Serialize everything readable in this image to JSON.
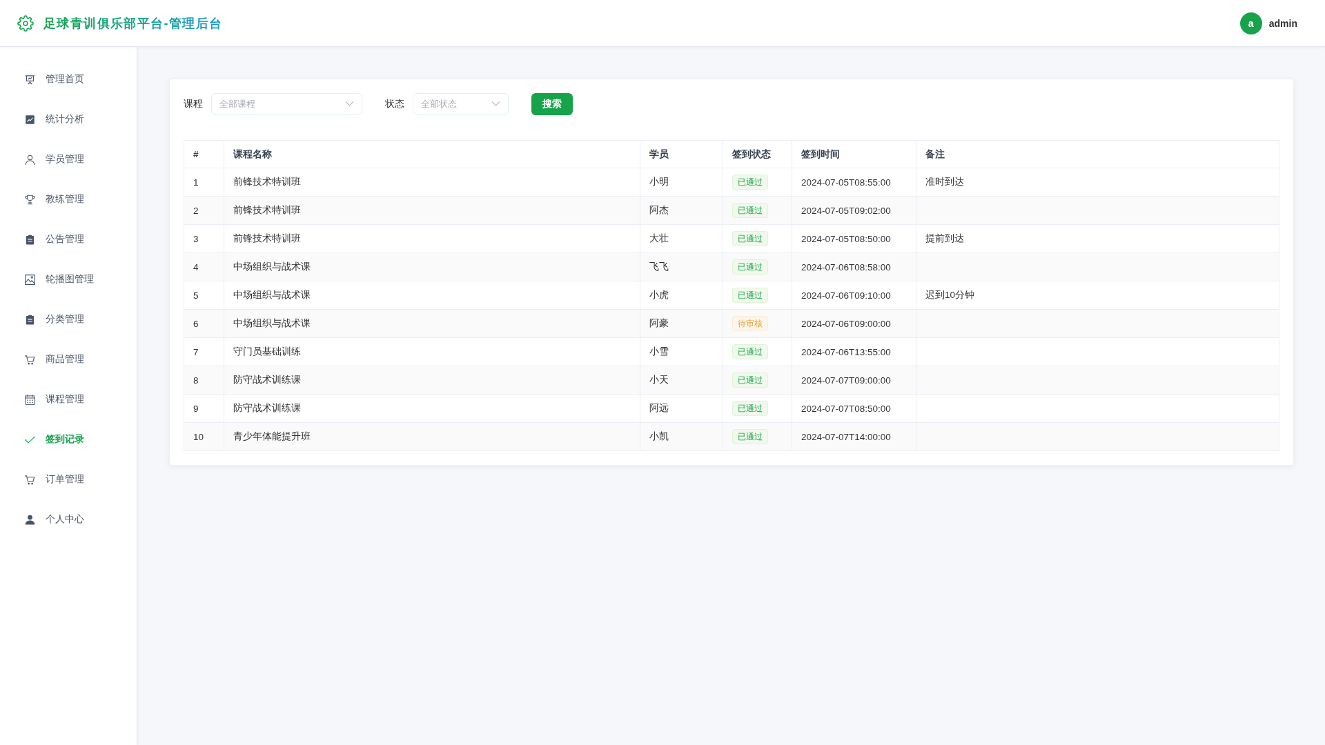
{
  "header": {
    "title": "足球青训俱乐部平台-管理后台",
    "user": {
      "avatar_letter": "a",
      "name": "admin"
    }
  },
  "sidebar": {
    "items": [
      {
        "label": "管理首页",
        "selected": false
      },
      {
        "label": "统计分析",
        "selected": false
      },
      {
        "label": "学员管理",
        "selected": false
      },
      {
        "label": "教练管理",
        "selected": false
      },
      {
        "label": "公告管理",
        "selected": false
      },
      {
        "label": "轮播图管理",
        "selected": false
      },
      {
        "label": "分类管理",
        "selected": false
      },
      {
        "label": "商品管理",
        "selected": false
      },
      {
        "label": "课程管理",
        "selected": false
      },
      {
        "label": "签到记录",
        "selected": true
      },
      {
        "label": "订单管理",
        "selected": false
      },
      {
        "label": "个人中心",
        "selected": false
      }
    ]
  },
  "filters": {
    "fields": [
      {
        "label": "课程",
        "placeholder": "全部课程"
      },
      {
        "label": "状态",
        "placeholder": "全部状态"
      }
    ],
    "search_button": "搜索"
  },
  "table": {
    "columns": [
      "#",
      "课程名称",
      "学员",
      "签到状态",
      "签到时间",
      "备注"
    ],
    "rows": [
      {
        "index": "1",
        "course": "前锋技术特训班",
        "student": "小明",
        "status": {
          "label": "已通过",
          "kind": "success"
        },
        "time": "2024-07-05T08:55:00",
        "note": "准时到达"
      },
      {
        "index": "2",
        "course": "前锋技术特训班",
        "student": "阿杰",
        "status": {
          "label": "已通过",
          "kind": "success"
        },
        "time": "2024-07-05T09:02:00"
      },
      {
        "index": "3",
        "course": "前锋技术特训班",
        "student": "大壮",
        "status": {
          "label": "已通过",
          "kind": "success"
        },
        "time": "2024-07-05T08:50:00",
        "note": "提前到达"
      },
      {
        "index": "4",
        "course": "中场组织与战术课",
        "student": "飞飞",
        "status": {
          "label": "已通过",
          "kind": "success"
        },
        "time": "2024-07-06T08:58:00"
      },
      {
        "index": "5",
        "course": "中场组织与战术课",
        "student": "小虎",
        "status": {
          "label": "已通过",
          "kind": "success"
        },
        "time": "2024-07-06T09:10:00",
        "note": "迟到10分钟"
      },
      {
        "index": "6",
        "course": "中场组织与战术课",
        "student": "阿豪",
        "status": {
          "label": "待审核",
          "kind": "warning"
        },
        "time": "2024-07-06T09:00:00"
      },
      {
        "index": "7",
        "course": "守门员基础训练",
        "student": "小雪",
        "status": {
          "label": "已通过",
          "kind": "success"
        },
        "time": "2024-07-06T13:55:00"
      },
      {
        "index": "8",
        "course": "防守战术训练课",
        "student": "小天",
        "status": {
          "label": "已通过",
          "kind": "success"
        },
        "time": "2024-07-07T09:00:00"
      },
      {
        "index": "9",
        "course": "防守战术训练课",
        "student": "阿远",
        "status": {
          "label": "已通过",
          "kind": "success"
        },
        "time": "2024-07-07T08:50:00"
      },
      {
        "index": "10",
        "course": "青少年体能提升班",
        "student": "小凯",
        "status": {
          "label": "已通过",
          "kind": "success"
        },
        "time": "2024-07-07T14:00:00"
      }
    ]
  }
}
